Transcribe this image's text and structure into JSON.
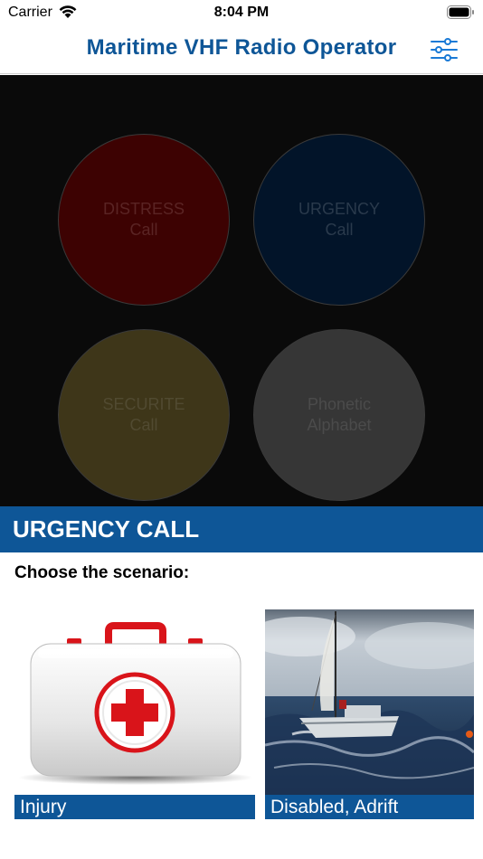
{
  "status_bar": {
    "carrier": "Carrier",
    "time": "8:04 PM"
  },
  "nav": {
    "title": "Maritime VHF Radio Operator",
    "settings_icon": "sliders-icon"
  },
  "menu": {
    "buttons": [
      {
        "line1": "DISTRESS",
        "line2": "Call",
        "color": "#3d0202"
      },
      {
        "line1": "URGENCY",
        "line2": "Call",
        "color": "#021429"
      },
      {
        "line1": "SECURITE",
        "line2": "Call",
        "color": "#3e3619"
      },
      {
        "line1": "Phonetic",
        "line2": "Alphabet",
        "color": "#363636"
      }
    ]
  },
  "section": {
    "title": "URGENCY CALL",
    "prompt": "Choose the scenario:"
  },
  "scenarios": [
    {
      "label": "Injury",
      "image": "first-aid-kit"
    },
    {
      "label": "Disabled, Adrift",
      "image": "sailboat-rough-sea"
    }
  ],
  "colors": {
    "accent": "#0e5697",
    "menu_background": "#0a0a0a"
  }
}
